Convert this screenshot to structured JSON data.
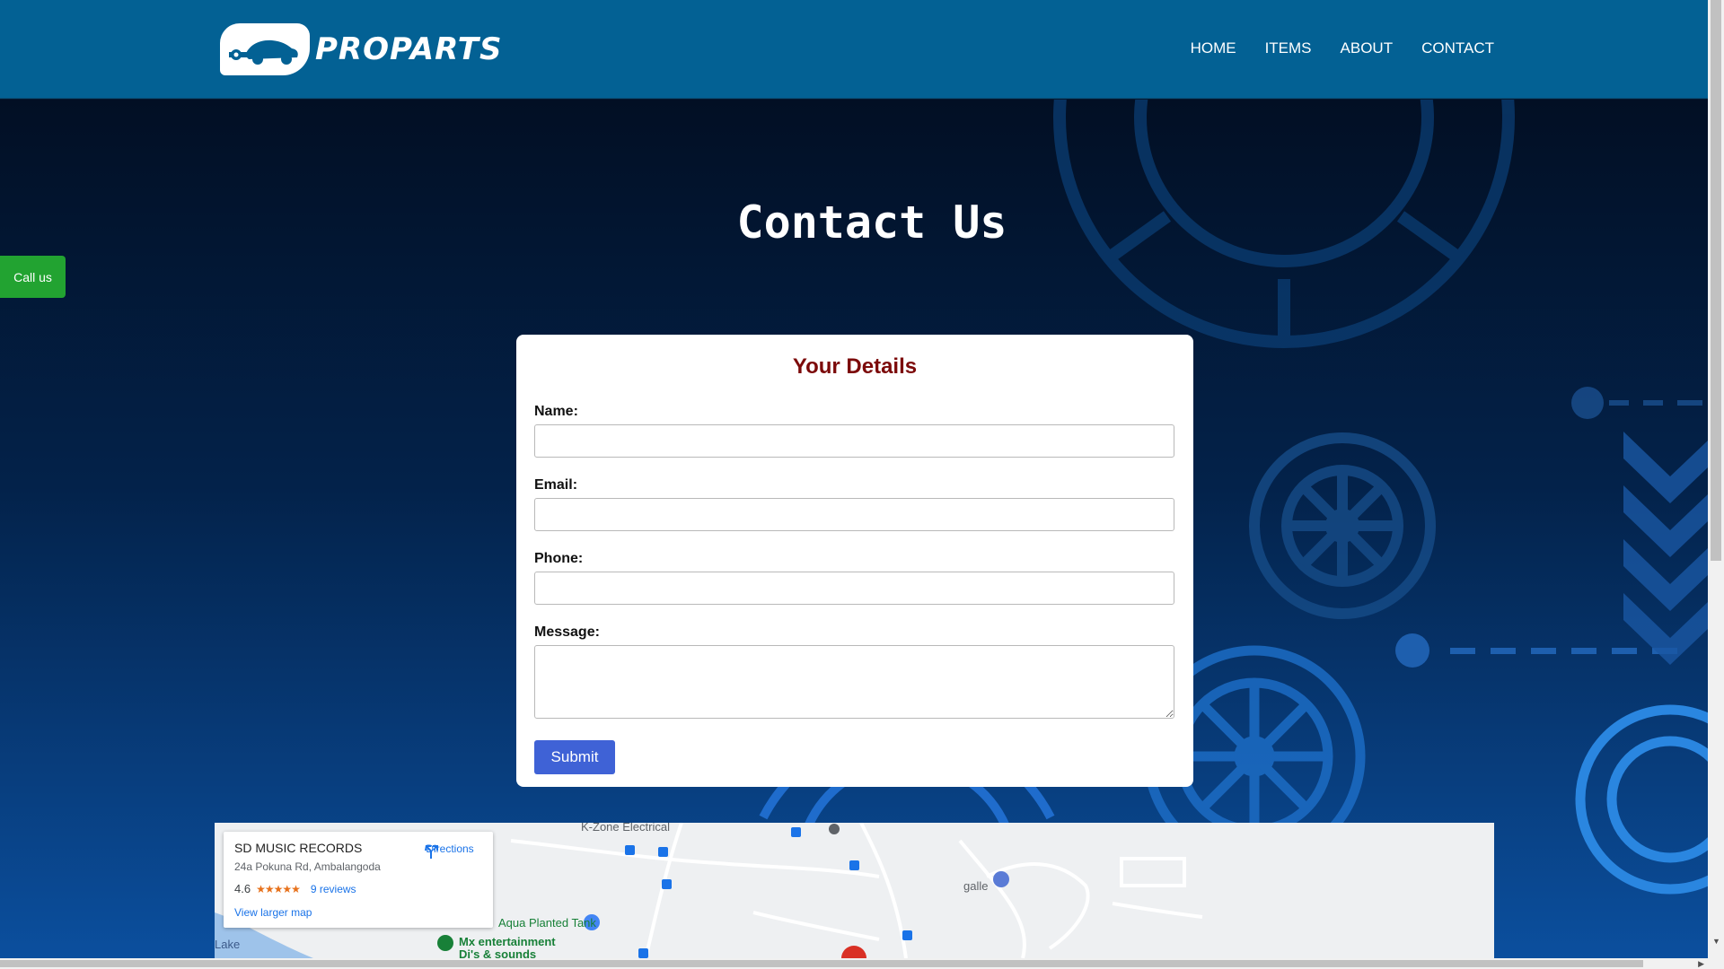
{
  "brand": {
    "name": "PROPARTS",
    "logo_icon": "car-key-icon"
  },
  "nav": {
    "items": [
      "HOME",
      "ITEMS",
      "ABOUT",
      "CONTACT"
    ]
  },
  "page": {
    "title": "Contact Us"
  },
  "callus": {
    "label": "Call us"
  },
  "form": {
    "heading": "Your Details",
    "name_label": "Name:",
    "email_label": "Email:",
    "phone_label": "Phone:",
    "message_label": "Message:",
    "name_value": "",
    "email_value": "",
    "phone_value": "",
    "message_value": "",
    "submit_label": "Submit"
  },
  "map": {
    "place_name": "SD MUSIC RECORDS",
    "address": "24a Pokuna Rd, Ambalangoda",
    "rating": "4.6",
    "stars": "★★★★★",
    "reviews": "9 reviews",
    "view_larger": "View larger map",
    "directions": "Directions",
    "labels": {
      "electrical": "K-Zone Electrical",
      "galle": "galle",
      "planted_tank": "Aqua Planted Tank",
      "mx_line1": "Mx entertainment",
      "mx_line2": "Dj's & sounds",
      "lake": "Lake"
    }
  },
  "colors": {
    "header": "#036194",
    "callus": "#22a331",
    "heading": "#7c0a0a",
    "submit": "#3f62d6"
  }
}
